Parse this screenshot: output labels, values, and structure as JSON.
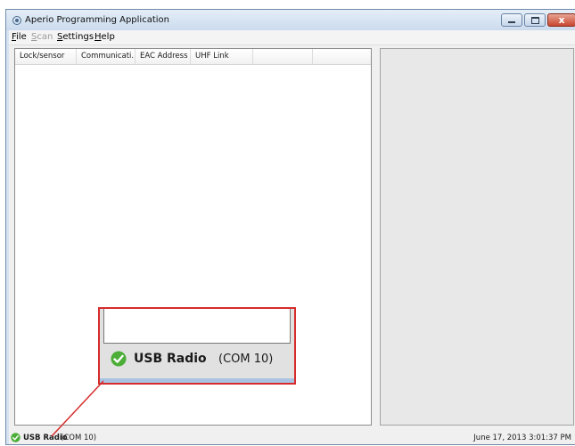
{
  "window": {
    "title": "Aperio Programming Application",
    "close_label": "x"
  },
  "menu": [
    {
      "label": "File",
      "enabled": true
    },
    {
      "label": "Scan",
      "enabled": false
    },
    {
      "label": "Settings",
      "enabled": true
    },
    {
      "label": "Help",
      "enabled": true
    }
  ],
  "list": {
    "columns": [
      "Lock/sensor",
      "Communicati...",
      "EAC Address",
      "UHF Link",
      ""
    ],
    "rows": []
  },
  "status": {
    "device": "USB Radio",
    "port": "(COM 10)",
    "datetime": "June 17, 2013 3:01:37 PM",
    "icon": "green-check-icon",
    "status_color": "#4cae38"
  },
  "zoom_callout": {
    "device": "USB Radio",
    "port": "(COM 10)",
    "icon": "green-check-icon"
  },
  "colors": {
    "callout_border": "#d72c2c",
    "window_frame": "#d6e3f1"
  }
}
